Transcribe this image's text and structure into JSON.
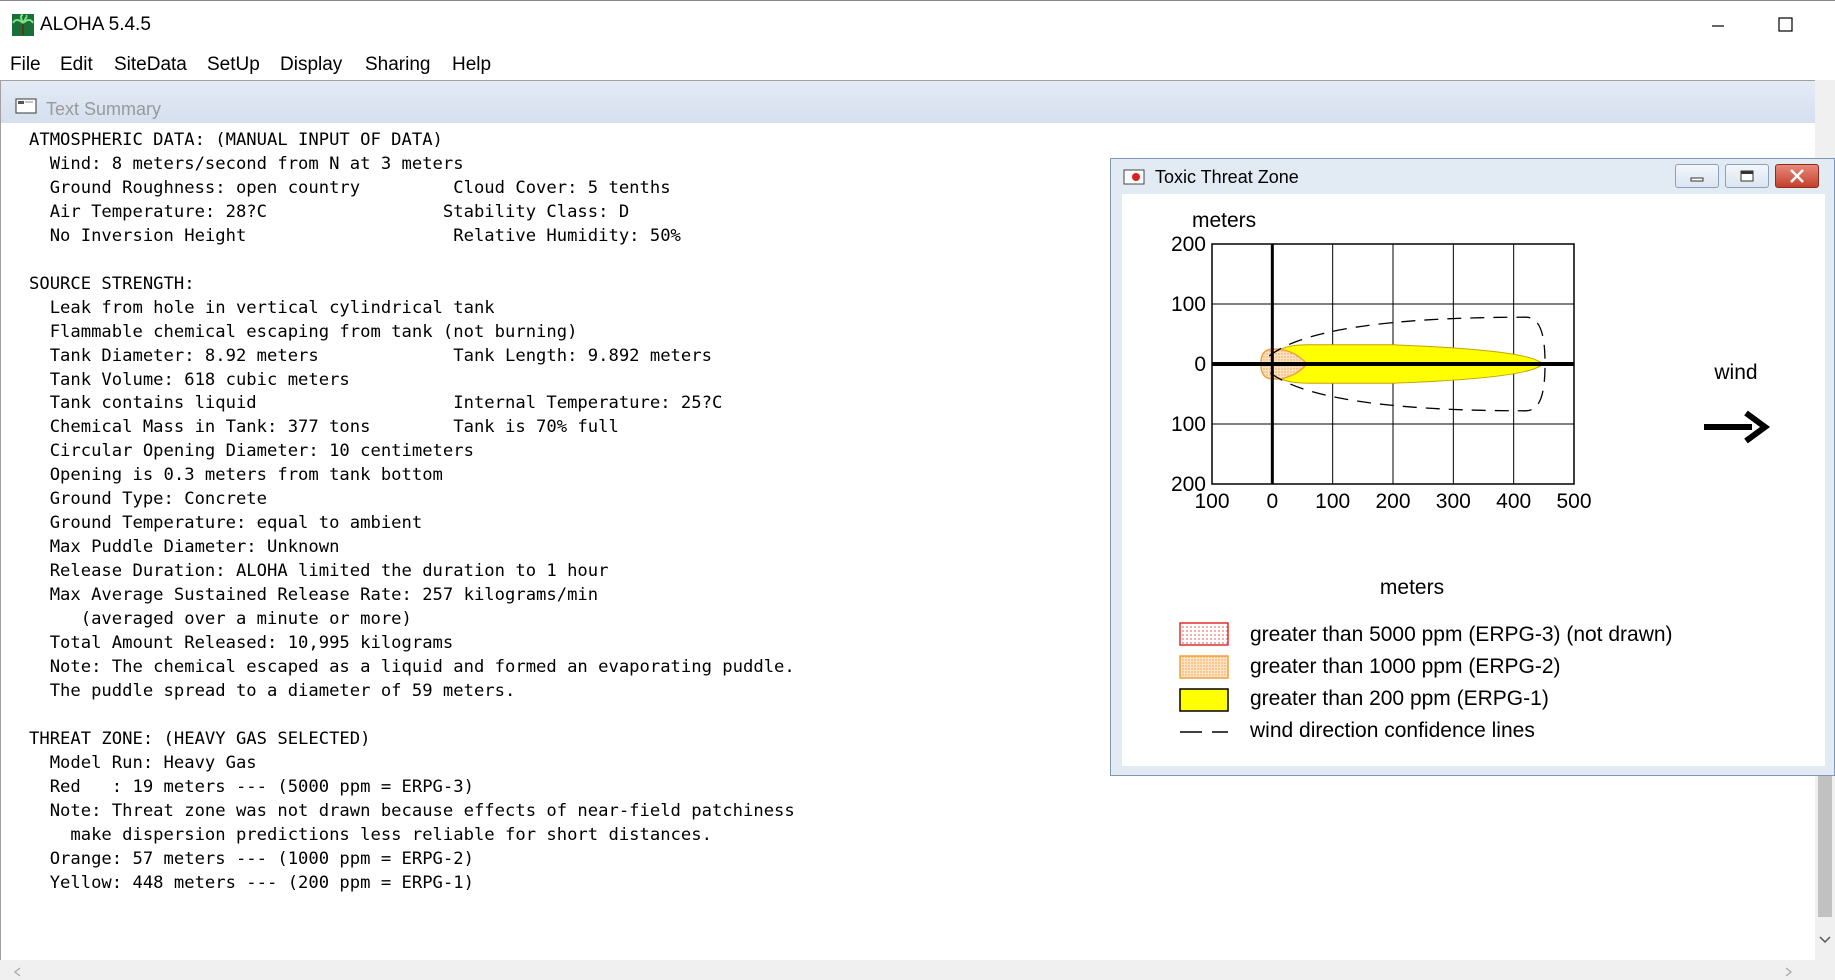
{
  "app": {
    "title": "ALOHA 5.4.5",
    "icon": "palm-tree-icon"
  },
  "menu": [
    "File",
    "Edit",
    "SiteData",
    "SetUp",
    "Display",
    "Sharing",
    "Help"
  ],
  "text_summary": {
    "title": "Text Summary",
    "lines": [
      "ATMOSPHERIC DATA: (MANUAL INPUT OF DATA)",
      "  Wind: 8 meters/second from N at 3 meters",
      "  Ground Roughness: open country         Cloud Cover: 5 tenths",
      "  Air Temperature: 28?C                 Stability Class: D",
      "  No Inversion Height                    Relative Humidity: 50%",
      "",
      "SOURCE STRENGTH:",
      "  Leak from hole in vertical cylindrical tank",
      "  Flammable chemical escaping from tank (not burning)",
      "  Tank Diameter: 8.92 meters             Tank Length: 9.892 meters",
      "  Tank Volume: 618 cubic meters",
      "  Tank contains liquid                   Internal Temperature: 25?C",
      "  Chemical Mass in Tank: 377 tons        Tank is 70% full",
      "  Circular Opening Diameter: 10 centimeters",
      "  Opening is 0.3 meters from tank bottom",
      "  Ground Type: Concrete",
      "  Ground Temperature: equal to ambient",
      "  Max Puddle Diameter: Unknown",
      "  Release Duration: ALOHA limited the duration to 1 hour",
      "  Max Average Sustained Release Rate: 257 kilograms/min",
      "     (averaged over a minute or more)",
      "  Total Amount Released: 10,995 kilograms",
      "  Note: The chemical escaped as a liquid and formed an evaporating puddle.",
      "  The puddle spread to a diameter of 59 meters.",
      "",
      "THREAT ZONE: (HEAVY GAS SELECTED)",
      "  Model Run: Heavy Gas",
      "  Red   : 19 meters --- (5000 ppm = ERPG-3)",
      "  Note: Threat zone was not drawn because effects of near-field patchiness",
      "    make dispersion predictions less reliable for short distances.",
      "  Orange: 57 meters --- (1000 ppm = ERPG-2)",
      "  Yellow: 448 meters --- (200 ppm = ERPG-1)"
    ]
  },
  "threat_zone": {
    "title": "Toxic Threat Zone",
    "y_label": "meters",
    "x_label": "meters",
    "y_ticks": [
      "200",
      "100",
      "0",
      "100",
      "200"
    ],
    "x_ticks": [
      "100",
      "0",
      "100",
      "200",
      "300",
      "400",
      "500"
    ],
    "wind_label": "wind",
    "x_range": [
      -100,
      500
    ],
    "y_range": [
      -200,
      200
    ],
    "zones": {
      "red_extent_m": 19,
      "orange_extent_m": 57,
      "yellow_extent_m": 448
    },
    "colors": {
      "red": "#e03030",
      "orange": "#f0a040",
      "yellow": "#ffff00"
    },
    "legend": [
      {
        "label": "greater than 5000 ppm (ERPG-3) (not drawn)",
        "style": "red-dotted"
      },
      {
        "label": "greater than 1000 ppm (ERPG-2)",
        "style": "orange-dotted"
      },
      {
        "label": "greater than 200 ppm (ERPG-1)",
        "style": "yellow-solid"
      },
      {
        "label": "wind direction confidence lines",
        "style": "dashed"
      }
    ]
  }
}
